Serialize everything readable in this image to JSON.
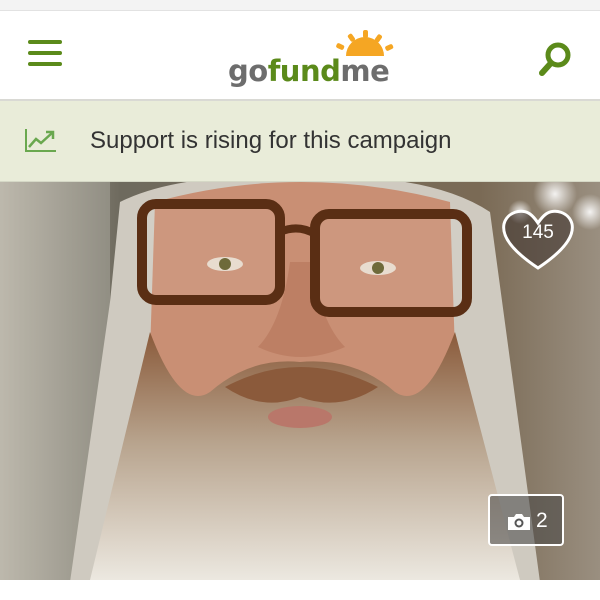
{
  "header": {
    "logo": {
      "part1": "go",
      "part2": "fund",
      "part3": "me"
    },
    "menu_icon": "hamburger-icon",
    "search_icon": "search-icon"
  },
  "banner": {
    "icon": "trending-up-icon",
    "text": "Support is rising for this campaign"
  },
  "campaign_photo": {
    "hearts": "145",
    "photo_count": "2",
    "camera_icon": "camera-icon"
  },
  "colors": {
    "brand_green": "#5b8a1a",
    "banner_bg": "#e9ecd9",
    "logo_sun": "#f5a623"
  }
}
